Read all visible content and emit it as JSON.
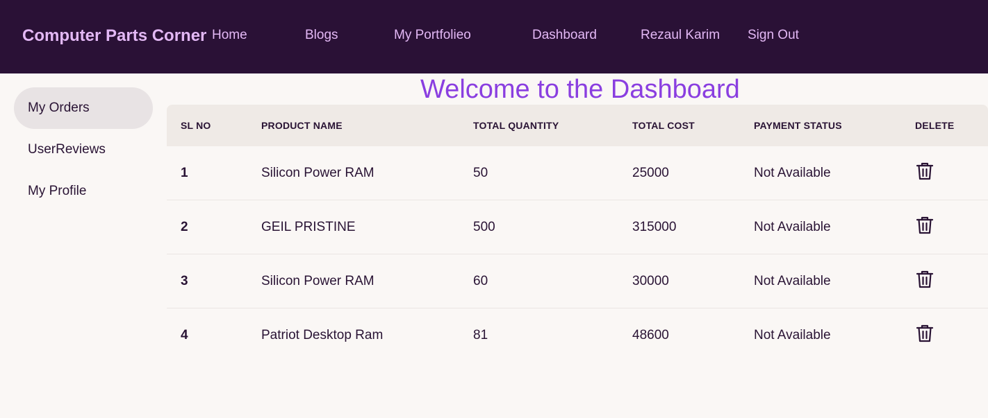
{
  "navbar": {
    "brand": "Computer Parts Corner",
    "links": [
      "Home",
      "Blogs",
      "My Portfolieo",
      "Dashboard",
      "Rezaul Karim",
      "Sign Out"
    ]
  },
  "sidebar": {
    "items": [
      {
        "label": "My Orders",
        "active": true
      },
      {
        "label": "UserReviews",
        "active": false
      },
      {
        "label": "My Profile",
        "active": false
      }
    ]
  },
  "main": {
    "title": "Welcome to the Dashboard"
  },
  "table": {
    "headers": [
      "SL NO",
      "PRODUCT NAME",
      "TOTAL QUANTITY",
      "TOTAL COST",
      "PAYMENT STATUS",
      "DELETE"
    ],
    "rows": [
      {
        "sl": "1",
        "name": "Silicon Power RAM",
        "qty": "50",
        "cost": "25000",
        "status": "Not Available",
        "action_icon": "trash-icon"
      },
      {
        "sl": "2",
        "name": "GEIL PRISTINE",
        "qty": "500",
        "cost": "315000",
        "status": "Not Available",
        "action_icon": "trash-icon"
      },
      {
        "sl": "3",
        "name": "Silicon Power RAM",
        "qty": "60",
        "cost": "30000",
        "status": "Not Available",
        "action_icon": "trash-icon"
      },
      {
        "sl": "4",
        "name": "Patriot Desktop Ram",
        "qty": "81",
        "cost": "48600",
        "status": "Not Available",
        "action_icon": "trash-icon"
      }
    ]
  },
  "colors": {
    "navbar_bg": "#2a1136",
    "nav_text": "#e3b8f5",
    "title": "#8a3ee0",
    "page_bg": "#faf7f5"
  }
}
